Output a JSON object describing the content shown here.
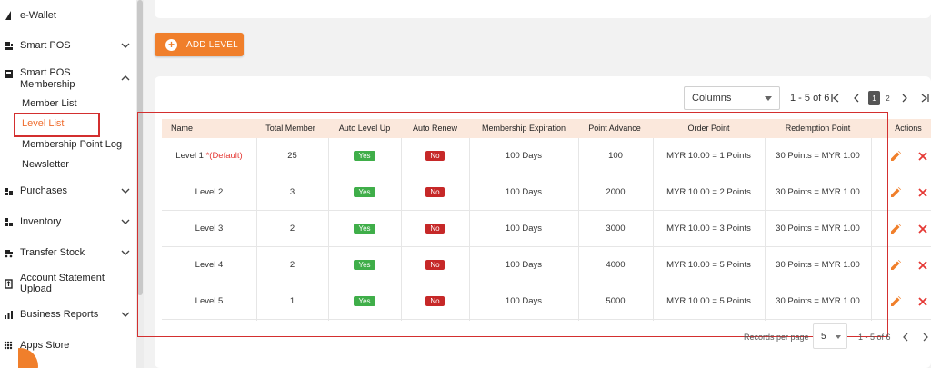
{
  "sidebar": {
    "ewallet": "e-Wallet",
    "smart_pos": "Smart POS",
    "membership_line1": "Smart POS",
    "membership_line2": "Membership",
    "sub_member_list": "Member List",
    "sub_level_list": "Level List",
    "sub_point_log": "Membership Point Log",
    "sub_newsletter": "Newsletter",
    "purchases": "Purchases",
    "inventory": "Inventory",
    "transfer_stock": "Transfer Stock",
    "account_statement": "Account Statement Upload",
    "business_reports": "Business Reports",
    "apps_store": "Apps Store"
  },
  "toolbar": {
    "add_level_label": "ADD LEVEL",
    "columns_value": "Columns"
  },
  "pagination": {
    "range": "1 - 5 of 6",
    "page1": "1",
    "page2": "2"
  },
  "table": {
    "headers": {
      "name": "Name",
      "total_member": "Total Member",
      "auto_level_up": "Auto Level Up",
      "auto_renew": "Auto Renew",
      "expiration": "Membership Expiration",
      "point_advance": "Point Advance",
      "order_point": "Order Point",
      "redemption_point": "Redemption Point",
      "actions": "Actions"
    },
    "default_tag": "*(Default)",
    "rows": [
      {
        "name": "Level 1",
        "total": "25",
        "level_up": "Yes",
        "renew": "No",
        "expiration": "100 Days",
        "advance": "100",
        "order": "MYR 10.00 = 1 Points",
        "redeem": "30 Points = MYR 1.00"
      },
      {
        "name": "Level 2",
        "total": "3",
        "level_up": "Yes",
        "renew": "No",
        "expiration": "100 Days",
        "advance": "2000",
        "order": "MYR 10.00 = 2 Points",
        "redeem": "30 Points = MYR 1.00"
      },
      {
        "name": "Level 3",
        "total": "2",
        "level_up": "Yes",
        "renew": "No",
        "expiration": "100 Days",
        "advance": "3000",
        "order": "MYR 10.00 = 3 Points",
        "redeem": "30 Points = MYR 1.00"
      },
      {
        "name": "Level 4",
        "total": "2",
        "level_up": "Yes",
        "renew": "No",
        "expiration": "100 Days",
        "advance": "4000",
        "order": "MYR 10.00 = 5 Points",
        "redeem": "30 Points = MYR 1.00"
      },
      {
        "name": "Level 5",
        "total": "1",
        "level_up": "Yes",
        "renew": "No",
        "expiration": "100 Days",
        "advance": "5000",
        "order": "MYR 10.00 = 5 Points",
        "redeem": "30 Points = MYR 1.00"
      }
    ]
  },
  "footer": {
    "records_per_page_label": "Records per page",
    "records_per_page_value": "5",
    "range": "1 - 5 of 6"
  },
  "colors": {
    "accent": "#f07f2b",
    "header_bg": "#fbe8dc",
    "yes": "#3fae49",
    "no": "#c62828",
    "highlight": "#d32f2f"
  }
}
